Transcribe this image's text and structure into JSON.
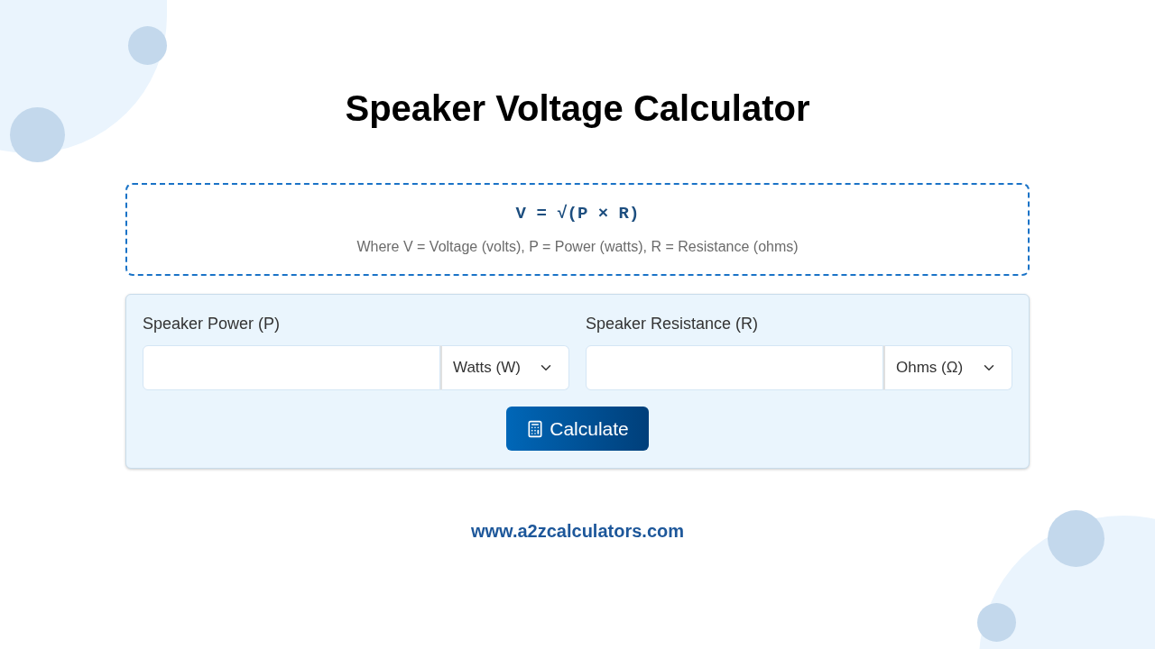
{
  "title": "Speaker Voltage Calculator",
  "formula": {
    "expression": "V = √(P × R)",
    "legend": "Where V = Voltage (volts), P = Power (watts), R = Resistance (ohms)"
  },
  "fields": [
    {
      "label": "Speaker Power (P)",
      "unit": "Watts (W)"
    },
    {
      "label": "Speaker Resistance (R)",
      "unit": "Ohms (Ω)"
    }
  ],
  "button": "Calculate",
  "footer": "www.a2zcalculators.com"
}
